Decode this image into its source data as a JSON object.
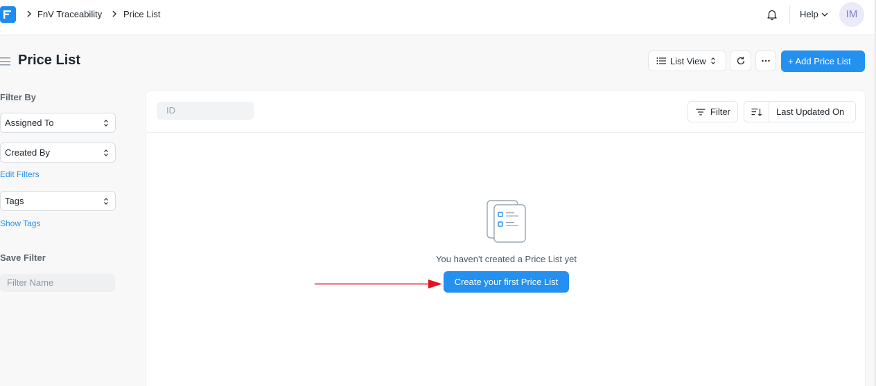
{
  "navbar": {
    "logo_icon": "frappe-logo-icon",
    "breadcrumbs": [
      "FnV Traceability",
      "Price List"
    ],
    "help_label": "Help",
    "avatar_initials": "IM"
  },
  "page": {
    "title": "Price List",
    "list_view_label": "List View",
    "add_button_label": "+ Add Price List"
  },
  "sidebar": {
    "filter_by_heading": "Filter By",
    "assigned_to": "Assigned To",
    "created_by": "Created By",
    "edit_filters": "Edit Filters",
    "tags": "Tags",
    "show_tags": "Show Tags",
    "save_filter_heading": "Save Filter",
    "filter_name_placeholder": "Filter Name"
  },
  "list": {
    "id_placeholder": "ID",
    "filter_label": "Filter",
    "sort_label": "Last Updated On",
    "empty_message": "You haven't created a Price List yet",
    "create_button_label": "Create your first Price List"
  },
  "colors": {
    "primary": "#2490ef",
    "annotation_arrow": "#e8121e"
  }
}
